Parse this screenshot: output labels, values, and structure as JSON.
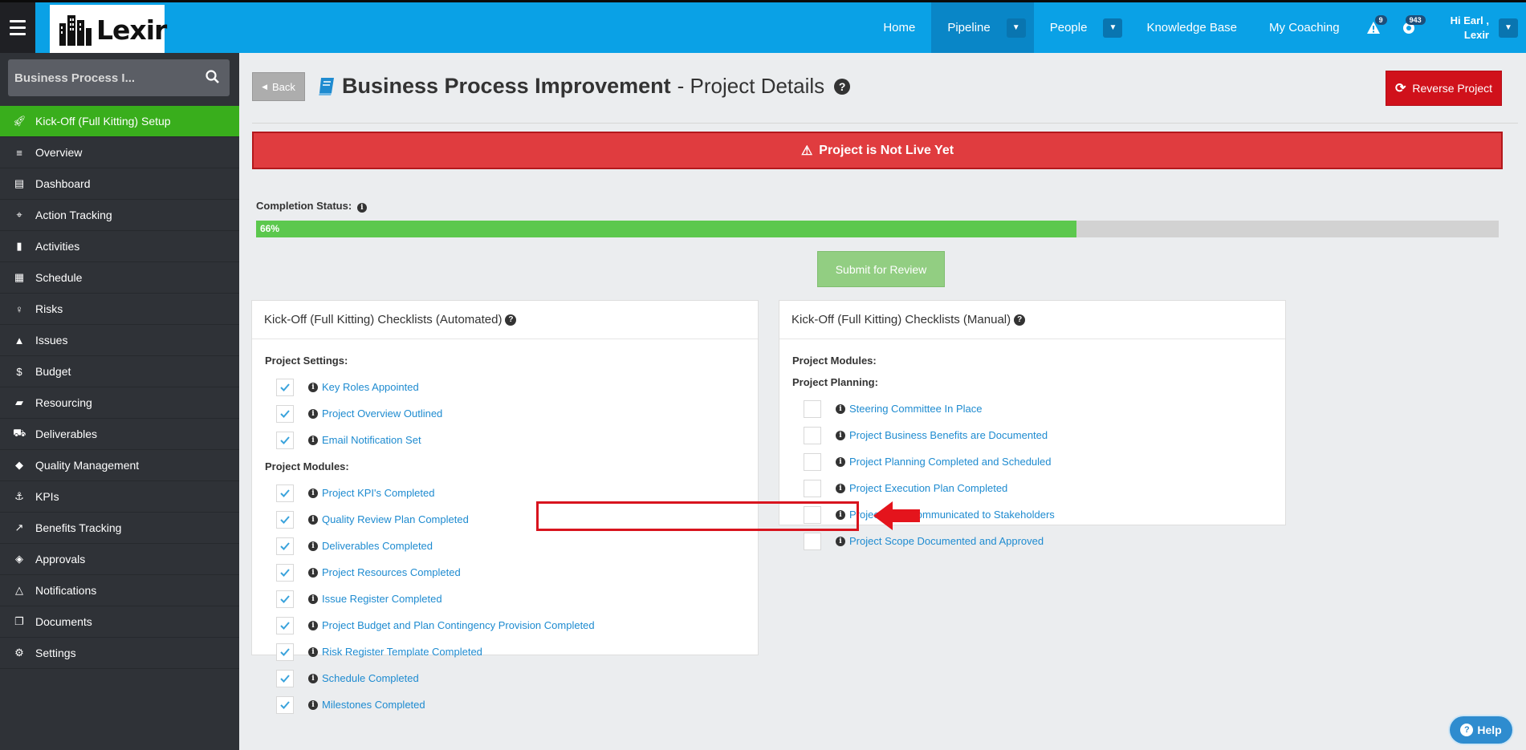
{
  "topbar": {
    "logo_text": "Lexir",
    "nav": [
      {
        "label": "Home"
      },
      {
        "label": "Pipeline"
      },
      {
        "label": "People"
      },
      {
        "label": "Knowledge Base"
      },
      {
        "label": "My Coaching"
      }
    ],
    "alerts_badge": "9",
    "notifications_badge": "943",
    "user_greeting": "Hi Earl ,",
    "user_name": "Lexir"
  },
  "sidebar": {
    "search_placeholder": "Business Process I...",
    "items": [
      {
        "label": "Kick-Off (Full Kitting) Setup",
        "icon": "rocket-icon"
      },
      {
        "label": "Overview",
        "icon": "align-left-icon"
      },
      {
        "label": "Dashboard",
        "icon": "id-card-icon"
      },
      {
        "label": "Action Tracking",
        "icon": "crosshairs-icon"
      },
      {
        "label": "Activities",
        "icon": "bookmark-icon"
      },
      {
        "label": "Schedule",
        "icon": "calendar-icon"
      },
      {
        "label": "Risks",
        "icon": "lightbulb-icon"
      },
      {
        "label": "Issues",
        "icon": "warning-icon"
      },
      {
        "label": "Budget",
        "icon": "dollar-icon"
      },
      {
        "label": "Resourcing",
        "icon": "folder-open-icon"
      },
      {
        "label": "Deliverables",
        "icon": "truck-icon"
      },
      {
        "label": "Quality Management",
        "icon": "tag-icon"
      },
      {
        "label": "KPIs",
        "icon": "anchor-icon"
      },
      {
        "label": "Benefits Tracking",
        "icon": "line-chart-icon"
      },
      {
        "label": "Approvals",
        "icon": "ticket-icon"
      },
      {
        "label": "Notifications",
        "icon": "bell-icon"
      },
      {
        "label": "Documents",
        "icon": "copy-icon"
      },
      {
        "label": "Settings",
        "icon": "cogs-icon"
      }
    ]
  },
  "header": {
    "back_label": "Back",
    "title": "Business Process Improvement",
    "subtitle": "- Project Details",
    "reverse_label": "Reverse Project"
  },
  "alert": {
    "text": "Project is Not Live Yet"
  },
  "completion": {
    "label": "Completion Status:",
    "percent": 66,
    "percent_label": "66%",
    "submit_label": "Submit for Review"
  },
  "automated": {
    "title": "Kick-Off (Full Kitting) Checklists (Automated)",
    "settings_label": "Project Settings:",
    "settings_items": [
      {
        "label": "Key Roles Appointed",
        "checked": true
      },
      {
        "label": "Project Overview Outlined",
        "checked": true
      },
      {
        "label": "Email Notification Set",
        "checked": true
      }
    ],
    "modules_label": "Project Modules:",
    "modules_items": [
      {
        "label": "Project KPI's Completed",
        "checked": true
      },
      {
        "label": "Quality Review Plan Completed",
        "checked": true
      },
      {
        "label": "Deliverables Completed",
        "checked": true
      },
      {
        "label": "Project Resources Completed",
        "checked": true
      },
      {
        "label": "Issue Register Completed",
        "checked": true
      },
      {
        "label": "Project Budget and Plan Contingency Provision Completed",
        "checked": true
      },
      {
        "label": "Risk Register Template Completed",
        "checked": true
      },
      {
        "label": "Schedule Completed",
        "checked": true
      },
      {
        "label": "Milestones Completed",
        "checked": true
      }
    ]
  },
  "manual": {
    "title": "Kick-Off (Full Kitting) Checklists (Manual)",
    "modules_label": "Project Modules:",
    "planning_label": "Project Planning:",
    "planning_items": [
      {
        "label": "Steering Committee In Place",
        "checked": false
      },
      {
        "label": "Project Business Benefits are Documented",
        "checked": false
      },
      {
        "label": "Project Planning Completed and Scheduled",
        "checked": false
      },
      {
        "label": "Project Execution Plan Completed",
        "checked": false
      },
      {
        "label": "Project Brief Communicated to Stakeholders",
        "checked": false
      },
      {
        "label": "Project Scope Documented and Approved",
        "checked": false
      }
    ]
  },
  "help_label": "Help",
  "colors": {
    "topbar": "#0aa1e6",
    "sidebar": "#2f3237",
    "active_menu": "#39ae1c",
    "alert": "#e03c3f",
    "progress": "#5cc84e",
    "link": "#1e8bd0",
    "reverse": "#d0111b"
  }
}
